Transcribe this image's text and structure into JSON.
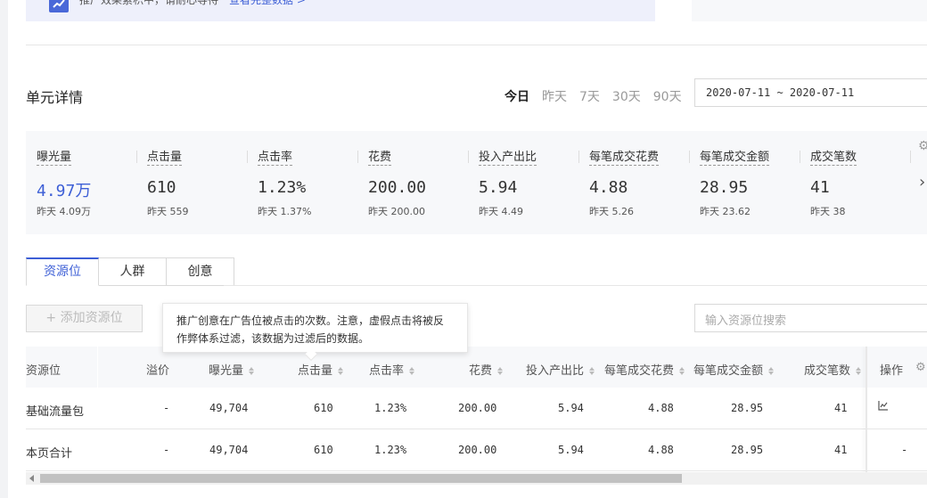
{
  "notice": {
    "text": "推广效果累积中，请耐心等待",
    "link": "查看完整数据 >"
  },
  "section_title": "单元详情",
  "range_tabs": [
    "今日",
    "昨天",
    "7天",
    "30天",
    "90天"
  ],
  "date_range": "2020-07-11 ~ 2020-07-11",
  "metrics": [
    {
      "label": "曝光量",
      "value": "4.97万",
      "prev": "昨天 4.09万"
    },
    {
      "label": "点击量",
      "value": "610",
      "prev": "昨天 559"
    },
    {
      "label": "点击率",
      "value": "1.23%",
      "prev": "昨天 1.37%"
    },
    {
      "label": "花费",
      "value": "200.00",
      "prev": "昨天 200.00"
    },
    {
      "label": "投入产出比",
      "value": "5.94",
      "prev": "昨天 4.49"
    },
    {
      "label": "每笔成交花费",
      "value": "4.88",
      "prev": "昨天 5.26"
    },
    {
      "label": "每笔成交金额",
      "value": "28.95",
      "prev": "昨天 23.62"
    },
    {
      "label": "成交笔数",
      "value": "41",
      "prev": "昨天 38"
    }
  ],
  "tabs": [
    "资源位",
    "人群",
    "创意"
  ],
  "add_button": "+ 添加资源位",
  "search_placeholder": "输入资源位搜索",
  "tooltip": "推广创意在广告位被点击的次数。注意，虚假点击将被反作弊体系过滤，该数据为过滤后的数据。",
  "table": {
    "headers": [
      "资源位",
      "溢价",
      "曝光量",
      "点击量",
      "点击率",
      "花费",
      "投入产出比",
      "每笔成交花费",
      "每笔成交金额",
      "成交笔数",
      "操作"
    ],
    "rows": [
      [
        "基础流量包",
        "-",
        "49,704",
        "610",
        "1.23%",
        "200.00",
        "5.94",
        "4.88",
        "28.95",
        "41",
        ""
      ],
      [
        "本页合计",
        "-",
        "49,704",
        "610",
        "1.23%",
        "200.00",
        "5.94",
        "4.88",
        "28.95",
        "41",
        "-"
      ]
    ]
  },
  "colors": {
    "accent": "#3d5fd6",
    "panel_bg": "#f7f8fa",
    "border": "#d9d9d9"
  }
}
